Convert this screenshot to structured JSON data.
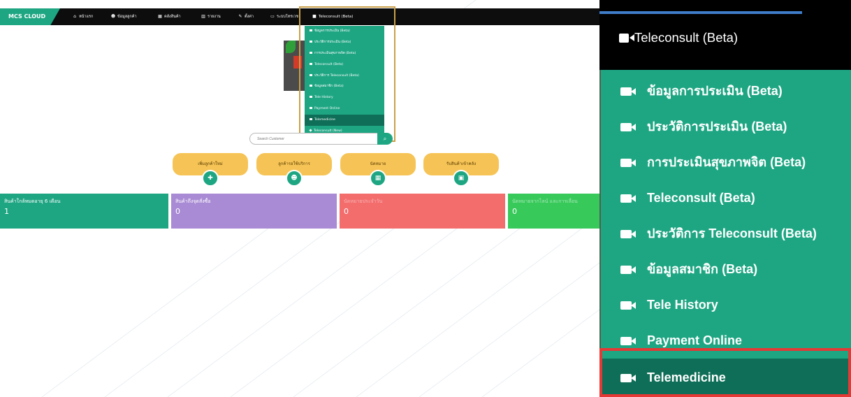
{
  "app": {
    "brand": "MCS CLOUD"
  },
  "topnav": {
    "items": [
      {
        "icon": "home-icon",
        "glyph": "⌂",
        "label": "หน้าแรก"
      },
      {
        "icon": "users-icon",
        "glyph": "☻",
        "label": "ข้อมูลลูกค้า"
      },
      {
        "icon": "table-icon",
        "glyph": "▦",
        "label": "คลังสินค้า"
      },
      {
        "icon": "chart-icon",
        "glyph": "▥",
        "label": "รายงาน"
      },
      {
        "icon": "wrench-icon",
        "glyph": "✎",
        "label": "ตั้งค่า"
      },
      {
        "icon": "monitor-icon",
        "glyph": "▭",
        "label": "ระบบโทรเวช"
      },
      {
        "icon": "video-icon",
        "glyph": "■",
        "label": "Teleconsult (Beta)"
      }
    ]
  },
  "dropdown": {
    "items": [
      {
        "label": "ข้อมูลการประเมิน (Beta)"
      },
      {
        "label": "ประวัติการประเมิน (Beta)"
      },
      {
        "label": "การประเมินสุขภาพจิต (Beta)"
      },
      {
        "label": "Teleconsult (Beta)"
      },
      {
        "label": "ประวัติการ Teleconsult (Beta)"
      },
      {
        "label": "ข้อมูลสมาชิก (Beta)"
      },
      {
        "label": "Tele History"
      },
      {
        "label": "Payment Online"
      },
      {
        "label": "Telemedicine",
        "active": true
      },
      {
        "label": "Teleconsult (New)"
      }
    ]
  },
  "search": {
    "placeholder": "Search Customer",
    "button_icon": "search-icon"
  },
  "quick_actions": [
    {
      "label": "เพิ่มลูกค้าใหม่",
      "icon": "add-user-icon",
      "glyph": "✚"
    },
    {
      "label": "ลูกค้ารอใช้บริการ",
      "icon": "group-icon",
      "glyph": "☻"
    },
    {
      "label": "นัดหมาย",
      "icon": "calendar-icon",
      "glyph": "▦"
    },
    {
      "label": "รับสินค้าเข้าคลัง",
      "icon": "box-icon",
      "glyph": "▣"
    }
  ],
  "stats": [
    {
      "label": "สินค้าใกล้หมดอายุ 6 เดือน",
      "value": "1",
      "color": "#1ea683"
    },
    {
      "label": "สินค้าถึงจุดสั่งซื้อ",
      "value": "0",
      "color": "#a98ad4"
    },
    {
      "label": "นัดหมายประจำวัน",
      "value": "0",
      "color": "#f46d6d"
    },
    {
      "label": "นัดหมายจากไลน์ และการเลื่อน",
      "value": "0",
      "color": "#37c95a"
    }
  ],
  "zoom_panel": {
    "title": "Teleconsult (Beta)",
    "items": [
      {
        "label": "ข้อมูลการประเมิน (Beta)"
      },
      {
        "label": "ประวัติการประเมิน (Beta)"
      },
      {
        "label": "การประเมินสุขภาพจิต (Beta)"
      },
      {
        "label": "Teleconsult (Beta)"
      },
      {
        "label": "ประวัติการ Teleconsult (Beta)"
      },
      {
        "label": "ข้อมูลสมาชิก (Beta)"
      },
      {
        "label": "Tele History"
      },
      {
        "label": "Payment Online"
      },
      {
        "label": "Telemedicine",
        "highlighted": true
      }
    ]
  },
  "colors": {
    "brand_green": "#1ea683",
    "active_green": "#0f6e57",
    "highlight_red": "#e53935",
    "highlight_gold": "#c9a04a",
    "button_yellow": "#f6c456"
  }
}
